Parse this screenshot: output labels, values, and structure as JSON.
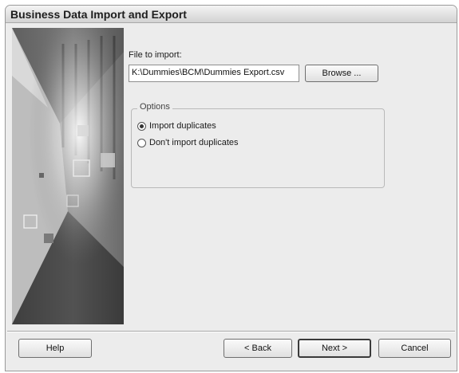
{
  "window": {
    "title": "Business Data Import and Export"
  },
  "import": {
    "file_label": "File to import:",
    "file_value": "K:\\Dummies\\BCM\\Dummies Export.csv",
    "browse_label": "Browse ..."
  },
  "options": {
    "legend": "Options",
    "items": [
      {
        "label": "Import duplicates",
        "checked": true
      },
      {
        "label": "Don't import duplicates",
        "checked": false
      }
    ]
  },
  "footer": {
    "help": "Help",
    "back": "< Back",
    "next": "Next >",
    "cancel": "Cancel"
  },
  "icons": {
    "radio_selected": "radio-selected-icon",
    "radio_unselected": "radio-unselected-icon",
    "wizard_art": "wizard-decorative-graphic"
  }
}
